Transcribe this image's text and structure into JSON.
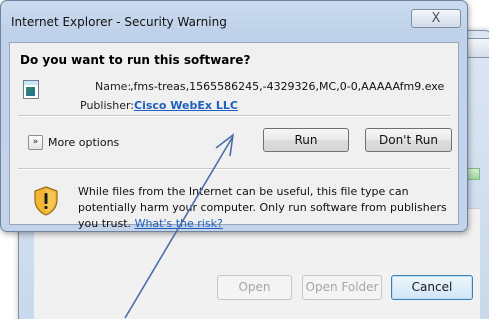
{
  "background_dialog": {
    "open_label": "Open",
    "open_folder_label": "Open Folder",
    "cancel_label": "Cancel",
    "close_glyph": "X"
  },
  "dialog": {
    "title": "Internet Explorer - Security Warning",
    "close_glyph": "X",
    "question": "Do you want to run this software?",
    "name_label": "Name:",
    "name_value": ",fms-treas,1565586245,-4329326,MC,0-0,AAAAAfm9.exe",
    "publisher_label": "Publisher:",
    "publisher_value": "Cisco WebEx LLC",
    "more_options_label": "More options",
    "more_options_glyph": "»",
    "run_label": "Run",
    "dont_run_label": "Don't Run",
    "warning_text": "While files from the Internet can be useful, this file type can potentially harm your computer. Only run software from publishers you trust.",
    "risk_link": "What's the risk?"
  },
  "icons": {
    "app": "application-icon",
    "warning": "shield-warning-icon",
    "more": "expand-chevron-icon",
    "close": "close-icon"
  },
  "colors": {
    "link": "#1f5fbf",
    "annotation_arrow": "#4a6fa8",
    "shield_amber": "#f2b632"
  }
}
